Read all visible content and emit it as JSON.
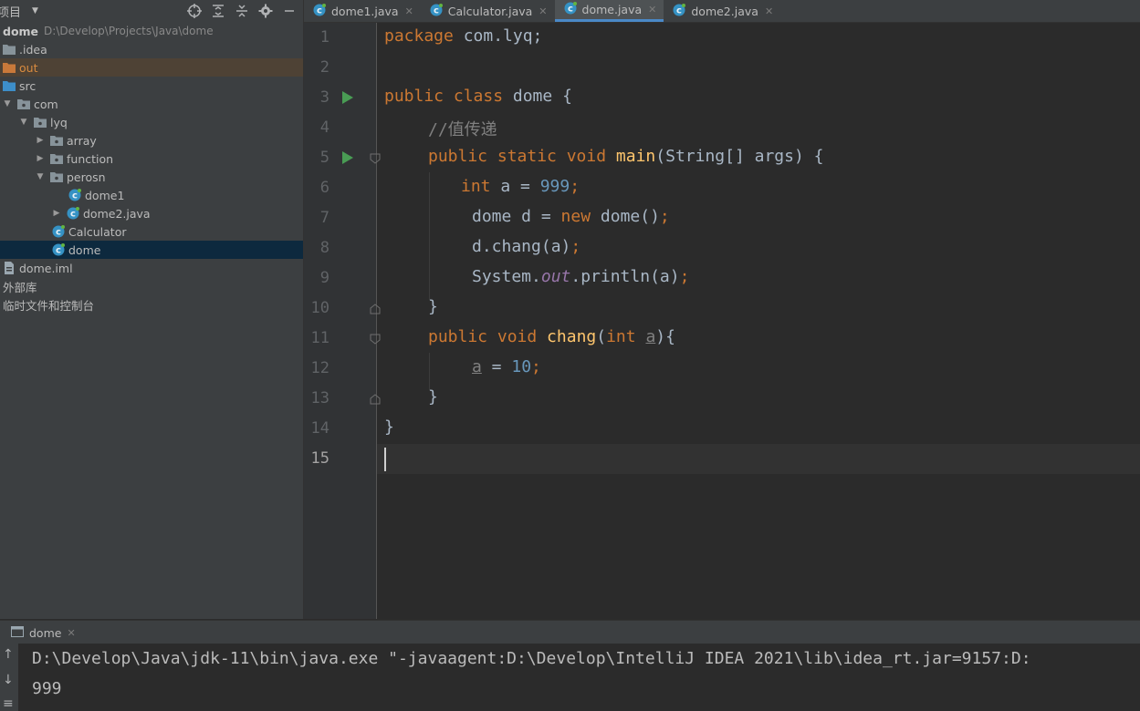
{
  "project_panel": {
    "title": "项目",
    "tree": [
      {
        "label": "dome",
        "path": "D:\\Develop\\Projects\\Java\\dome",
        "icon": "module-folder-icon"
      },
      {
        "label": ".idea",
        "icon": "folder-icon"
      },
      {
        "label": "out",
        "icon": "folder-orange-icon"
      },
      {
        "label": "src",
        "icon": "source-folder-icon"
      },
      {
        "label": "com",
        "icon": "package-icon"
      },
      {
        "label": "lyq",
        "icon": "package-icon"
      },
      {
        "label": "array",
        "icon": "package-icon"
      },
      {
        "label": "function",
        "icon": "package-icon"
      },
      {
        "label": "perosn",
        "icon": "package-icon"
      },
      {
        "label": "dome1",
        "icon": "java-class-icon"
      },
      {
        "label": "dome2.java",
        "icon": "java-class-icon"
      },
      {
        "label": "Calculator",
        "icon": "java-class-icon"
      },
      {
        "label": "dome",
        "icon": "java-class-icon"
      },
      {
        "label": "dome.iml",
        "icon": "iml-file-icon"
      },
      {
        "label": "外部库",
        "icon": "library-icon"
      },
      {
        "label": "临时文件和控制台",
        "icon": "scratch-icon"
      }
    ]
  },
  "tabs": [
    {
      "label": "dome1.java"
    },
    {
      "label": "Calculator.java"
    },
    {
      "label": "dome.java"
    },
    {
      "label": "dome2.java"
    }
  ],
  "line_numbers": [
    "1",
    "2",
    "3",
    "4",
    "5",
    "6",
    "7",
    "8",
    "9",
    "10",
    "11",
    "12",
    "13",
    "14",
    "15"
  ],
  "code": {
    "l1_kw": "package",
    "l1_rest": " com.lyq;",
    "l3_kw": "public class",
    "l3_rest": " dome {",
    "l4_cmt": "//值传递",
    "l5_kw": "public static void",
    "l5_fn": " main",
    "l5_rest": "(String[] args) {",
    "l6_kw": "int",
    "l6_mid": " a = ",
    "l6_num": "999",
    "l6_end": ";",
    "l7_a": "dome d = ",
    "l7_kw": "new",
    "l7_b": " dome()",
    "l7_end": ";",
    "l8_a": "d.chang(a)",
    "l8_end": ";",
    "l9_a": "System.",
    "l9_stat": "out",
    "l9_b": ".println(a)",
    "l9_end": ";",
    "l10": "}",
    "l11_kw": "public void",
    "l11_fn": " chang",
    "l11_p1": "(",
    "l11_kw2": "int",
    "l11_sp": " ",
    "l11_param": "a",
    "l11_p2": "){",
    "l12_param": "a",
    "l12_mid": " = ",
    "l12_num": "10",
    "l12_end": ";",
    "l13": "}",
    "l14": "}"
  },
  "run_panel": {
    "tab_label": "dome",
    "lines": [
      "D:\\Develop\\Java\\jdk-11\\bin\\java.exe \"-javaagent:D:\\Develop\\IntelliJ IDEA 2021\\lib\\idea_rt.jar=9157:D:",
      "999"
    ]
  },
  "colors": {
    "keyword": "#cc7832",
    "number": "#6897bb",
    "comment": "#808080",
    "method": "#ffc66d",
    "static_field": "#9876aa",
    "accent": "#4a88c7"
  }
}
